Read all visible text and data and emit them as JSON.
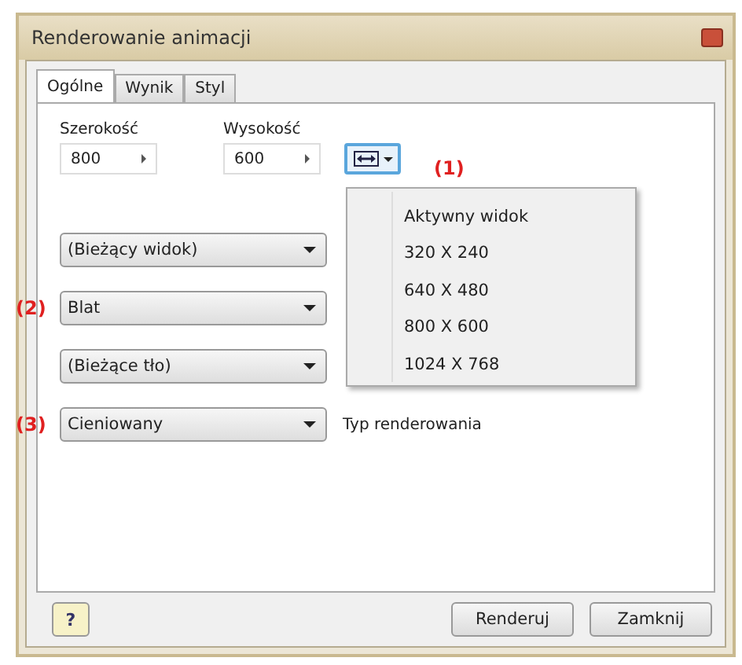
{
  "window": {
    "title": "Renderowanie animacji"
  },
  "tabs": [
    {
      "label": "Ogólne",
      "selected": true
    },
    {
      "label": "Wynik",
      "selected": false
    },
    {
      "label": "Styl",
      "selected": false
    }
  ],
  "size_fields": [
    {
      "label": "Szerokość",
      "value": "800"
    },
    {
      "label": "Wysokość",
      "value": "600"
    }
  ],
  "callout_1": "(1)",
  "size_menu": {
    "items": [
      "Aktywny widok",
      "320 X 240",
      "640 X 480",
      "800 X 600",
      "1024 X 768"
    ]
  },
  "dropdowns": [
    {
      "value": "(Bieżący widok)"
    },
    {
      "value": "Blat",
      "callout": "(2)"
    },
    {
      "value": "(Bieżące tło)"
    },
    {
      "value": "Cieniowany",
      "callout": "(3)",
      "label": "Typ renderowania"
    }
  ],
  "buttons": {
    "help": "?",
    "render": "Renderuj",
    "close": "Zamknij"
  }
}
